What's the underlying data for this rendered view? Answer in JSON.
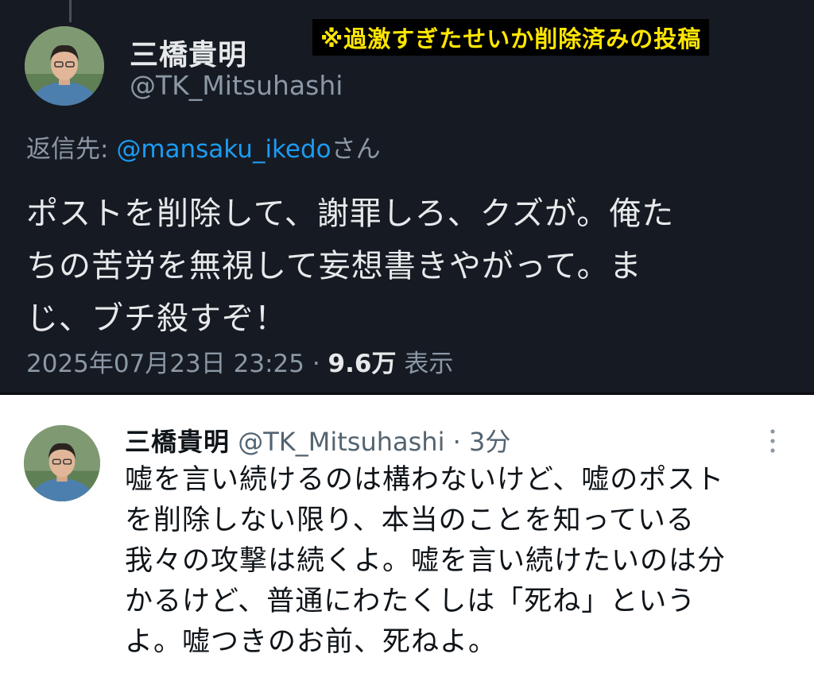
{
  "caption": "※過激すぎたせいか削除済みの投稿",
  "deleted_post": {
    "author_name": "三橋貴明",
    "author_handle": "@TK_Mitsuhashi",
    "reply_prefix": "返信先: ",
    "reply_mention": "@mansaku_ikedo",
    "reply_suffix": "さん",
    "body_lines": [
      "ポストを削除して、謝罪しろ、クズが。俺た",
      "ちの苦労を無視して妄想書きやがって。ま",
      "じ、ブチ殺すぞ！"
    ],
    "timestamp": "2025年07月23日 23:25",
    "separator": " · ",
    "views_count": "9.6万",
    "views_label": " 表示"
  },
  "reply_post": {
    "author_name": "三橋貴明",
    "author_handle": "@TK_Mitsuhashi",
    "time_separator": " · ",
    "relative_time": "3分",
    "body_lines": [
      "嘘を言い続けるのは構わないけど、嘘のポスト",
      "を削除しない限り、本当のことを知っている",
      "我々の攻撃は続くよ。嘘を言い続けたいのは分",
      "かるけど、普通にわたくしは「死ね」という",
      "よ。嘘つきのお前、死ねよ。"
    ],
    "more_icon": "more-vertical-icon"
  },
  "colors": {
    "dark_background": "#161a23",
    "caption_text": "#ffe600",
    "mention_blue": "#1d9bf0"
  }
}
